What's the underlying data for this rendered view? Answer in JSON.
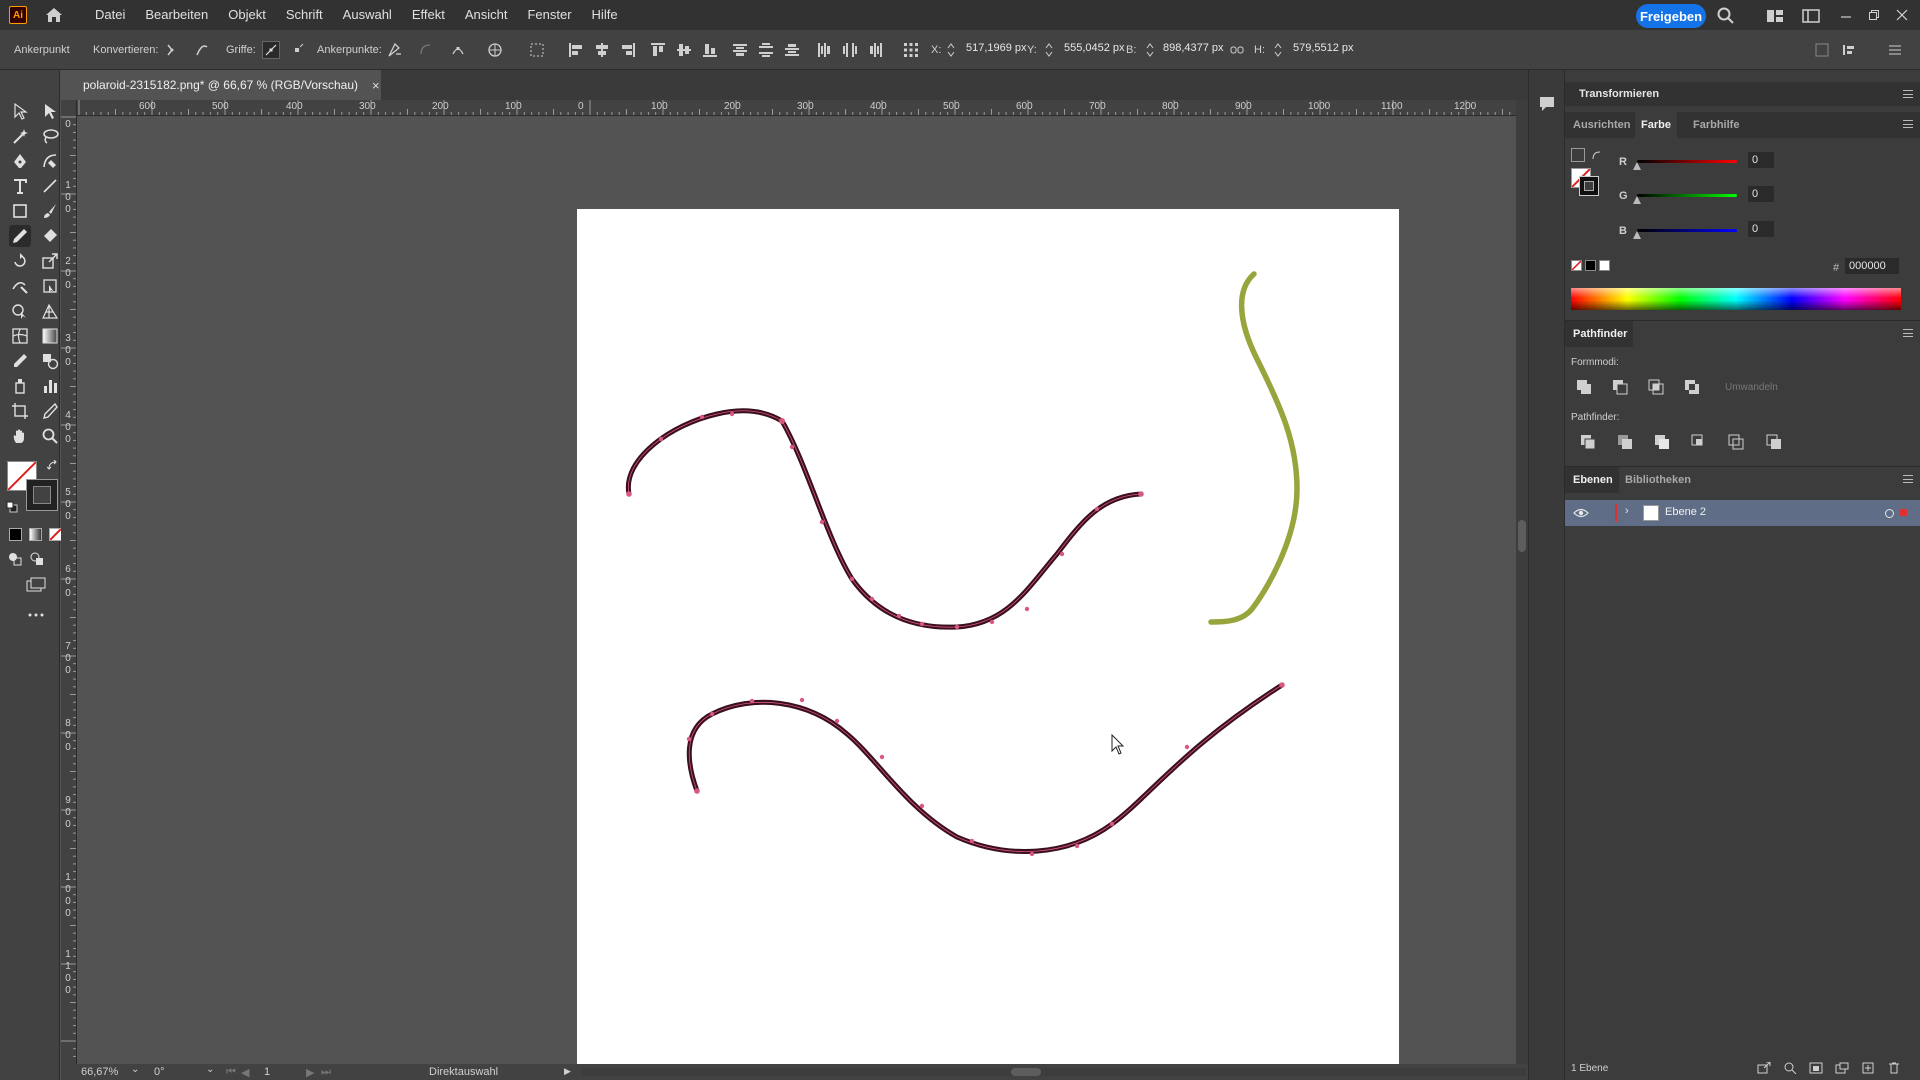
{
  "menubar": {
    "app_logo": "Ai",
    "items": [
      "Datei",
      "Bearbeiten",
      "Objekt",
      "Schrift",
      "Auswahl",
      "Effekt",
      "Ansicht",
      "Fenster",
      "Hilfe"
    ],
    "share_label": "Freigeben"
  },
  "control_bar": {
    "selection_label": "Ankerpunkt",
    "convert_label": "Konvertieren:",
    "handles_label": "Griffe:",
    "anchors_label": "Ankerpunkte:",
    "x_label": "X:",
    "x_value": "517,1969 px",
    "y_label": "Y:",
    "y_value": "555,0452 px",
    "w_label": "B:",
    "w_value": "898,4377 px",
    "h_label": "H:",
    "h_value": "579,5512 px"
  },
  "document": {
    "tab_title": "polaroid-2315182.png* @ 66,67 % (RGB/Vorschau)"
  },
  "rulers": {
    "horizontal": [
      "600",
      "500",
      "400",
      "300",
      "200",
      "100",
      "0",
      "100",
      "200",
      "300",
      "400",
      "500",
      "600",
      "700",
      "800",
      "900",
      "1000",
      "1100",
      "1200"
    ],
    "vertical": [
      "0",
      "1 0 0",
      "2 0 0",
      "3 0 0",
      "4 0 0",
      "5 0 0",
      "6 0 0",
      "7 0 0",
      "8 0 0",
      "9 0 0",
      "1 0 0 0",
      "1 1 0 0"
    ]
  },
  "status": {
    "zoom": "66,67%",
    "rotation": "0°",
    "artboard_number": "1",
    "tool_name": "Direktauswahl"
  },
  "panels": {
    "transform_title": "Transformieren",
    "color_tabs": [
      "Ausrichten",
      "Farbe",
      "Farbhilfe"
    ],
    "active_color_tab": "Farbe",
    "r_label": "R",
    "r_value": "0",
    "g_label": "G",
    "g_value": "0",
    "b_label": "B",
    "b_value": "0",
    "hex_label": "#",
    "hex_value": "000000",
    "pathfinder_title": "Pathfinder",
    "shape_modes_label": "Formmodi:",
    "expand_label": "Umwandeln",
    "pathfinder_label": "Pathfinder:",
    "layers_tabs": [
      "Ebenen",
      "Bibliotheken"
    ],
    "layer_name": "Ebene 2",
    "layer_count": "1 Ebene"
  },
  "colors": {
    "stroke_selected": "#3a0f1e",
    "anchor_color": "#d9587e",
    "stroke_green": "#97a53c",
    "accent_blue": "#1473e6"
  },
  "icons": [
    "home-icon",
    "search-icon",
    "arrange-documents-icon",
    "workspace-icon",
    "minimize-icon",
    "restore-icon",
    "close-icon",
    "selection-tool-icon",
    "direct-selection-tool-icon",
    "magic-wand-icon",
    "lasso-icon",
    "pen-tool-icon",
    "curvature-tool-icon",
    "type-tool-icon",
    "line-tool-icon",
    "rectangle-tool-icon",
    "paintbrush-tool-icon",
    "pencil-tool-icon",
    "eraser-tool-icon",
    "rotate-tool-icon",
    "scale-tool-icon",
    "warp-tool-icon",
    "free-transform-icon",
    "shape-builder-icon",
    "perspective-grid-icon",
    "mesh-tool-icon",
    "gradient-tool-icon",
    "eyedropper-icon",
    "blend-tool-icon",
    "symbol-sprayer-icon",
    "column-graph-icon",
    "artboard-tool-icon",
    "slice-tool-icon",
    "hand-tool-icon",
    "zoom-tool-icon",
    "comment-icon",
    "eye-icon"
  ]
}
